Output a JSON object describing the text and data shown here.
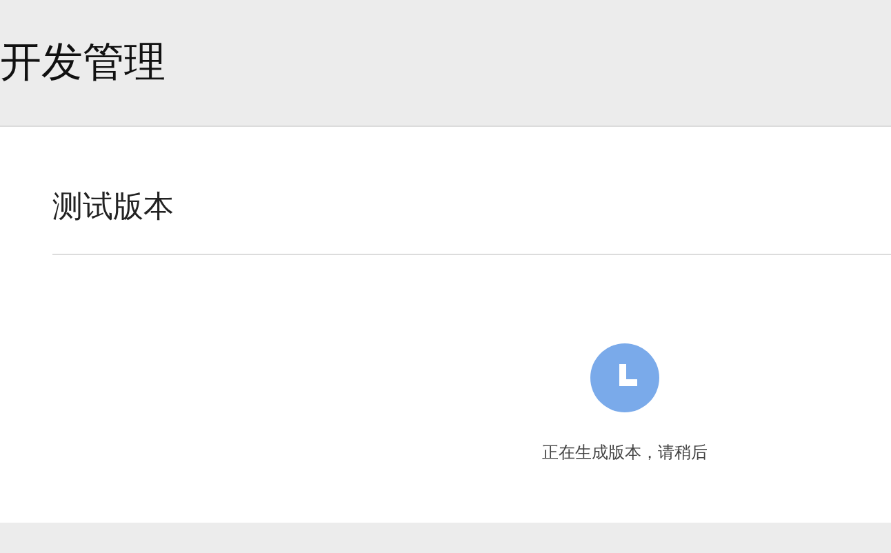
{
  "header": {
    "title": "开发管理"
  },
  "section": {
    "title": "测试版本",
    "status": {
      "kind": "pending",
      "message": "正在生成版本，请稍后"
    }
  }
}
